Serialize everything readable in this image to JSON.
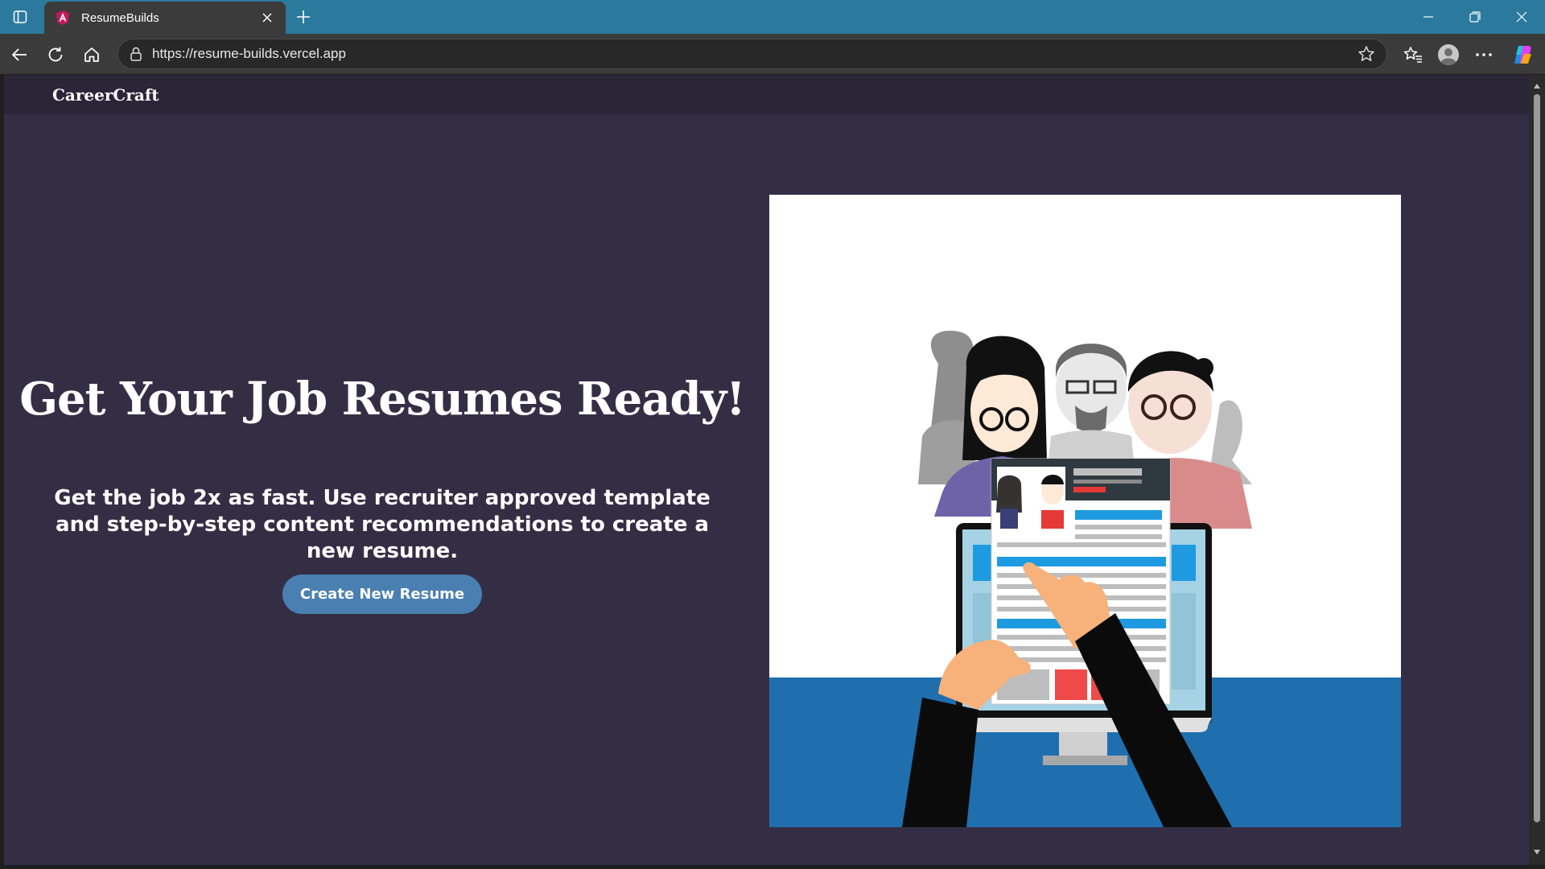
{
  "browser": {
    "tab_title": "ResumeBuilds",
    "url": "https://resume-builds.vercel.app",
    "colors": {
      "titlebar": "#2b7a9e",
      "toolbar": "#3b3b3b"
    },
    "icons": [
      "tab-actions-icon",
      "favicon-icon",
      "close-icon",
      "plus-icon",
      "minimize-icon",
      "restore-icon",
      "close-window-icon",
      "back-icon",
      "refresh-icon",
      "home-icon",
      "lock-icon",
      "star-icon",
      "favorites-icon",
      "profile-icon",
      "more-icon",
      "copilot-icon"
    ]
  },
  "site": {
    "brand": "CareerCraft",
    "hero": {
      "title": "Get Your Job Resumes Ready!",
      "subtitle": "Get the job 2x as fast. Use recruiter approved template and step-by-step content recommendations to create a new resume.",
      "cta_label": "Create New Resume"
    },
    "colors": {
      "page_bg": "#342e45",
      "nav_bg": "#2b2538",
      "cta_bg": "#4a7fb1",
      "illustration_band": "#1f6fae"
    }
  }
}
